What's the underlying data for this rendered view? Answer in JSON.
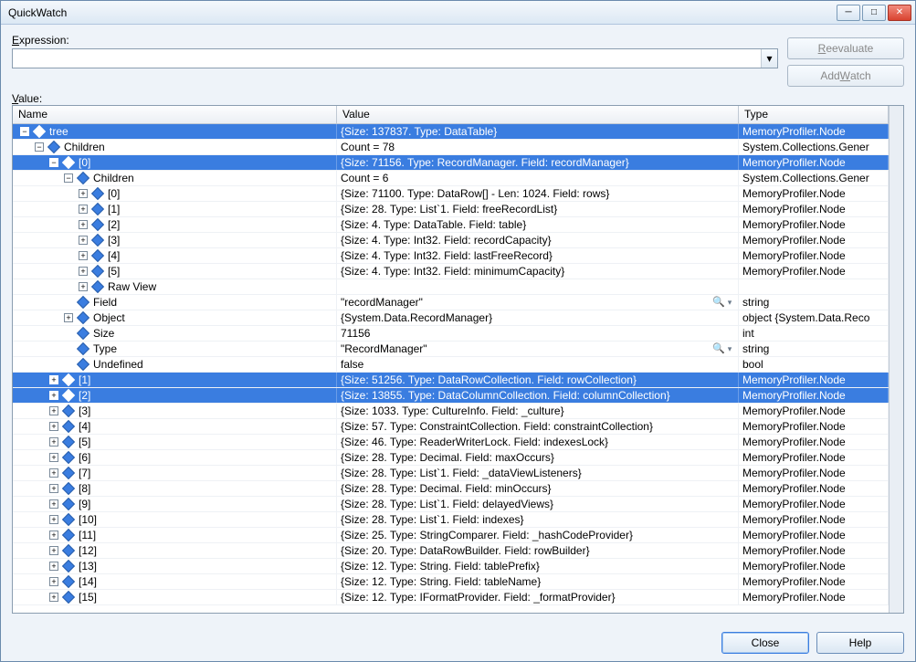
{
  "window": {
    "title": "QuickWatch"
  },
  "labels": {
    "expression": "Expression:",
    "value": "Value:"
  },
  "buttons": {
    "reevaluate": "Reevaluate",
    "addwatch": "Add Watch",
    "close": "Close",
    "help": "Help"
  },
  "columns": {
    "name": "Name",
    "value": "Value",
    "type": "Type"
  },
  "expression_value": "",
  "rows": [
    {
      "indent": 0,
      "exp": "-",
      "icon": true,
      "name": "tree",
      "value": "{Size: 137837. Type: DataTable}",
      "type": "MemoryProfiler.Node",
      "sel": true
    },
    {
      "indent": 1,
      "exp": "-",
      "icon": true,
      "name": "Children",
      "value": "Count = 78",
      "type": "System.Collections.Gener",
      "sel": false
    },
    {
      "indent": 2,
      "exp": "-",
      "icon": true,
      "name": "[0]",
      "value": "{Size: 71156. Type: RecordManager. Field: recordManager}",
      "type": "MemoryProfiler.Node",
      "sel": true
    },
    {
      "indent": 3,
      "exp": "-",
      "icon": true,
      "name": "Children",
      "value": "Count = 6",
      "type": "System.Collections.Gener",
      "sel": false
    },
    {
      "indent": 4,
      "exp": "+",
      "icon": true,
      "name": "[0]",
      "value": "{Size: 71100. Type: DataRow[] - Len: 1024. Field: rows}",
      "type": "MemoryProfiler.Node",
      "sel": false
    },
    {
      "indent": 4,
      "exp": "+",
      "icon": true,
      "name": "[1]",
      "value": "{Size: 28. Type: List`1. Field: freeRecordList}",
      "type": "MemoryProfiler.Node",
      "sel": false
    },
    {
      "indent": 4,
      "exp": "+",
      "icon": true,
      "name": "[2]",
      "value": "{Size: 4. Type: DataTable. Field: table}",
      "type": "MemoryProfiler.Node",
      "sel": false
    },
    {
      "indent": 4,
      "exp": "+",
      "icon": true,
      "name": "[3]",
      "value": "{Size: 4. Type: Int32. Field: recordCapacity}",
      "type": "MemoryProfiler.Node",
      "sel": false
    },
    {
      "indent": 4,
      "exp": "+",
      "icon": true,
      "name": "[4]",
      "value": "{Size: 4. Type: Int32. Field: lastFreeRecord}",
      "type": "MemoryProfiler.Node",
      "sel": false
    },
    {
      "indent": 4,
      "exp": "+",
      "icon": true,
      "name": "[5]",
      "value": "{Size: 4. Type: Int32. Field: minimumCapacity}",
      "type": "MemoryProfiler.Node",
      "sel": false
    },
    {
      "indent": 4,
      "exp": "+",
      "icon": true,
      "name": "Raw View",
      "value": "",
      "type": "",
      "sel": false
    },
    {
      "indent": 3,
      "exp": "",
      "icon": true,
      "name": "Field",
      "value": "\"recordManager\"",
      "type": "string",
      "sel": false,
      "mag": true
    },
    {
      "indent": 3,
      "exp": "+",
      "icon": true,
      "name": "Object",
      "value": "{System.Data.RecordManager}",
      "type": "object {System.Data.Reco",
      "sel": false
    },
    {
      "indent": 3,
      "exp": "",
      "icon": true,
      "name": "Size",
      "value": "71156",
      "type": "int",
      "sel": false
    },
    {
      "indent": 3,
      "exp": "",
      "icon": true,
      "name": "Type",
      "value": "\"RecordManager\"",
      "type": "string",
      "sel": false,
      "mag": true
    },
    {
      "indent": 3,
      "exp": "",
      "icon": true,
      "name": "Undefined",
      "value": "false",
      "type": "bool",
      "sel": false
    },
    {
      "indent": 2,
      "exp": "+",
      "icon": true,
      "name": "[1]",
      "value": "{Size: 51256. Type: DataRowCollection. Field: rowCollection}",
      "type": "MemoryProfiler.Node",
      "sel": true
    },
    {
      "indent": 2,
      "exp": "+",
      "icon": true,
      "name": "[2]",
      "value": "{Size: 13855. Type: DataColumnCollection. Field: columnCollection}",
      "type": "MemoryProfiler.Node",
      "sel": true
    },
    {
      "indent": 2,
      "exp": "+",
      "icon": true,
      "name": "[3]",
      "value": "{Size: 1033. Type: CultureInfo. Field: _culture}",
      "type": "MemoryProfiler.Node",
      "sel": false
    },
    {
      "indent": 2,
      "exp": "+",
      "icon": true,
      "name": "[4]",
      "value": "{Size: 57. Type: ConstraintCollection. Field: constraintCollection}",
      "type": "MemoryProfiler.Node",
      "sel": false
    },
    {
      "indent": 2,
      "exp": "+",
      "icon": true,
      "name": "[5]",
      "value": "{Size: 46. Type: ReaderWriterLock. Field: indexesLock}",
      "type": "MemoryProfiler.Node",
      "sel": false
    },
    {
      "indent": 2,
      "exp": "+",
      "icon": true,
      "name": "[6]",
      "value": "{Size: 28. Type: Decimal. Field: maxOccurs}",
      "type": "MemoryProfiler.Node",
      "sel": false
    },
    {
      "indent": 2,
      "exp": "+",
      "icon": true,
      "name": "[7]",
      "value": "{Size: 28. Type: List`1. Field: _dataViewListeners}",
      "type": "MemoryProfiler.Node",
      "sel": false
    },
    {
      "indent": 2,
      "exp": "+",
      "icon": true,
      "name": "[8]",
      "value": "{Size: 28. Type: Decimal. Field: minOccurs}",
      "type": "MemoryProfiler.Node",
      "sel": false
    },
    {
      "indent": 2,
      "exp": "+",
      "icon": true,
      "name": "[9]",
      "value": "{Size: 28. Type: List`1. Field: delayedViews}",
      "type": "MemoryProfiler.Node",
      "sel": false
    },
    {
      "indent": 2,
      "exp": "+",
      "icon": true,
      "name": "[10]",
      "value": "{Size: 28. Type: List`1. Field: indexes}",
      "type": "MemoryProfiler.Node",
      "sel": false
    },
    {
      "indent": 2,
      "exp": "+",
      "icon": true,
      "name": "[11]",
      "value": "{Size: 25. Type: StringComparer. Field: _hashCodeProvider}",
      "type": "MemoryProfiler.Node",
      "sel": false
    },
    {
      "indent": 2,
      "exp": "+",
      "icon": true,
      "name": "[12]",
      "value": "{Size: 20. Type: DataRowBuilder. Field: rowBuilder}",
      "type": "MemoryProfiler.Node",
      "sel": false
    },
    {
      "indent": 2,
      "exp": "+",
      "icon": true,
      "name": "[13]",
      "value": "{Size: 12. Type: String. Field: tablePrefix}",
      "type": "MemoryProfiler.Node",
      "sel": false
    },
    {
      "indent": 2,
      "exp": "+",
      "icon": true,
      "name": "[14]",
      "value": "{Size: 12. Type: String. Field: tableName}",
      "type": "MemoryProfiler.Node",
      "sel": false
    },
    {
      "indent": 2,
      "exp": "+",
      "icon": true,
      "name": "[15]",
      "value": "{Size: 12. Type: IFormatProvider. Field: _formatProvider}",
      "type": "MemoryProfiler.Node",
      "sel": false
    }
  ]
}
